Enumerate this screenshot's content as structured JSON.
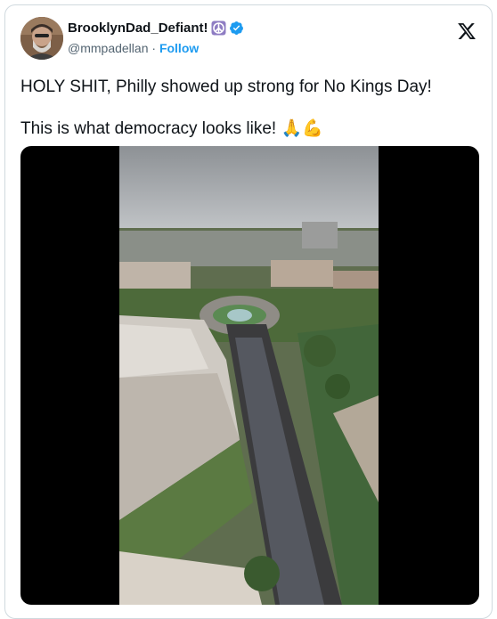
{
  "tweet": {
    "display_name": "BrooklynDad_Defiant!",
    "handle": "@mmpadellan",
    "separator": "·",
    "follow_label": "Follow",
    "text_line1": "HOLY SHIT, Philly showed up strong for No Kings Day!",
    "text_line2": "This is what democracy looks like!",
    "emoji_line2": "🙏💪"
  },
  "icons": {
    "name_badge_1": "peace-symbol-icon",
    "name_badge_2": "verified-check-icon",
    "platform": "x-logo-icon"
  },
  "colors": {
    "follow": "#1d9bf0",
    "verified": "#1d9bf0",
    "peace_badge": "#8e7cc3",
    "border": "#cfd9de",
    "muted_text": "#536471"
  }
}
